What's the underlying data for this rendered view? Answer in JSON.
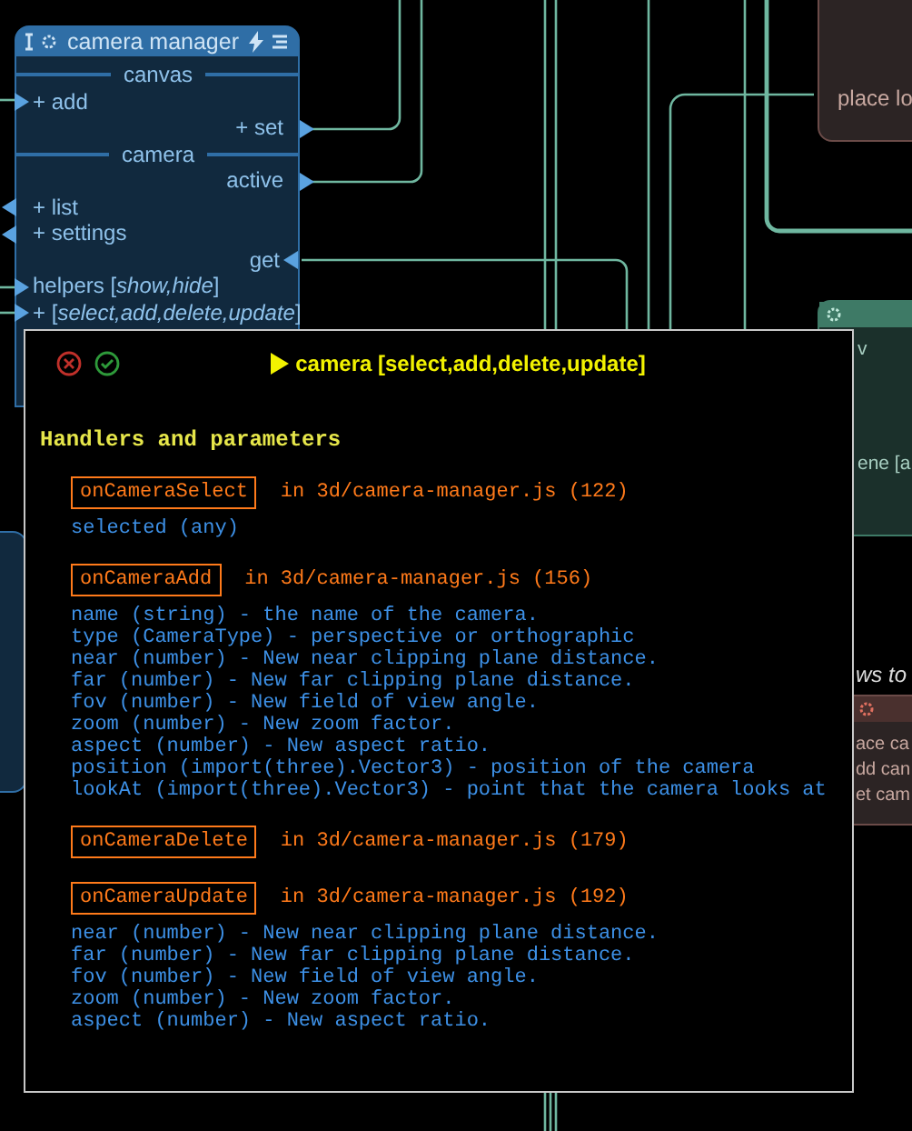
{
  "main_node": {
    "title": "camera manager",
    "rows": [
      {
        "kind": "section",
        "label": "canvas"
      },
      {
        "kind": "left-in",
        "label": "+ add"
      },
      {
        "kind": "right-out",
        "label": "+ set"
      },
      {
        "kind": "section",
        "label": "camera"
      },
      {
        "kind": "right-out",
        "label": "active"
      },
      {
        "kind": "left-out",
        "label": "+ list"
      },
      {
        "kind": "left-out",
        "label": "+ settings"
      },
      {
        "kind": "right-in",
        "label": "get"
      },
      {
        "kind": "left-in",
        "label": "helpers [*show,hide*]"
      },
      {
        "kind": "left-in",
        "label": "+ [*select,add,delete,update*]"
      }
    ]
  },
  "background_nodes": [
    {
      "kind": "brown",
      "texts": [
        "place lo"
      ]
    },
    {
      "kind": "green",
      "texts": [
        "v",
        "ene [a"
      ]
    },
    {
      "kind": "caption",
      "texts": [
        "ws to"
      ]
    },
    {
      "kind": "brown-lower",
      "texts": [
        "ace ca",
        "dd can",
        "et cam"
      ]
    },
    {
      "kind": "blue-edge"
    }
  ],
  "popup": {
    "title": "camera [select,add,delete,update]",
    "heading": "Handlers and parameters",
    "handlers": [
      {
        "name": "onCameraSelect",
        "location": "in 3d/camera-manager.js (122)",
        "params": [
          "selected (any)"
        ]
      },
      {
        "name": "onCameraAdd",
        "location": "in 3d/camera-manager.js (156)",
        "params": [
          "name (string) - the name of the camera.",
          "type (CameraType) - perspective or orthographic",
          "near (number) - New near clipping plane distance.",
          "far (number) - New far clipping plane distance.",
          "fov (number) - New field of view angle.",
          "zoom (number) - New zoom factor.",
          "aspect (number) - New aspect ratio.",
          "position (import(three).Vector3) - position of the camera",
          "lookAt (import(three).Vector3) - point that the camera looks at"
        ]
      },
      {
        "name": "onCameraDelete",
        "location": "in 3d/camera-manager.js (179)"
      },
      {
        "name": "onCameraUpdate",
        "location": "in 3d/camera-manager.js (192)",
        "params": [
          "near (number) - New near clipping plane distance.",
          "far (number) - New far clipping plane distance.",
          "fov (number) - New field of view angle.",
          "zoom (number) - New zoom factor.",
          "aspect (number) - New aspect ratio."
        ]
      }
    ]
  }
}
